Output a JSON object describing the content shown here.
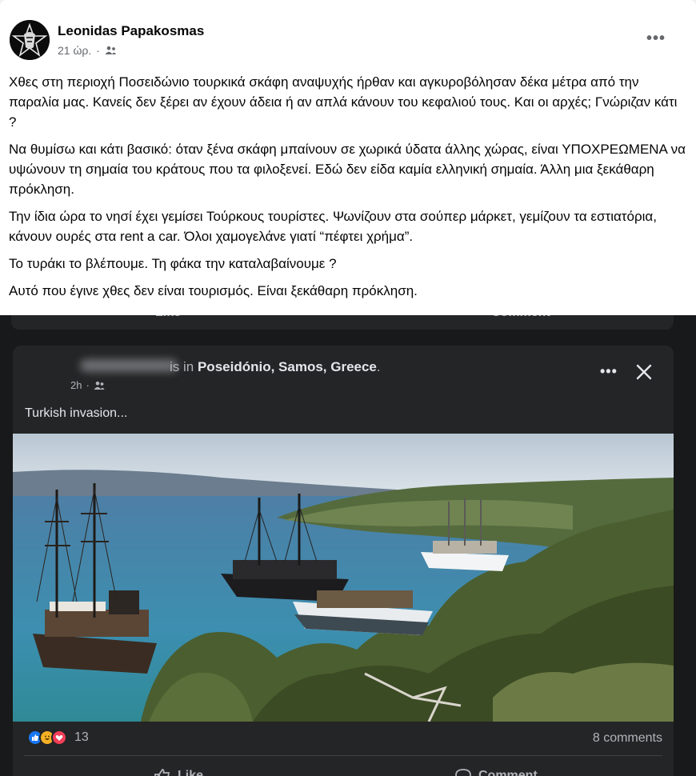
{
  "post": {
    "author": "Leonidas Papakosmas",
    "time": "21 ώρ.",
    "audience_icon": "friends-icon",
    "paragraphs": [
      "Χθες στη περιοχή Ποσειδώνιο τουρκικά σκάφη αναψυχής ήρθαν και αγκυροβόλησαν δέκα μέτρα από την παραλία μας. Κανείς δεν ξέρει αν έχουν άδεια ή αν απλά κάνουν του κεφαλιού τους. Και οι αρχές; Γνώριζαν κάτι ?",
      "Να θυμίσω και κάτι βασικό: όταν ξένα σκάφη μπαίνουν σε χωρικά ύδατα άλλης χώρας, είναι ΥΠΟΧΡΕΩΜΕΝΑ να υψώνουν τη σημαία του κράτους που τα φιλοξενεί. Εδώ δεν είδα καμία ελληνική σημαία. Άλλη μια ξεκάθαρη πρόκληση.",
      "Την ίδια ώρα το νησί έχει γεμίσει Τούρκους τουρίστες. Ψωνίζουν στα σούπερ μάρκετ, γεμίζουν τα εστιατόρια, κάνουν ουρές στα rent a car. Όλοι χαμογελάνε γιατί “πέφτει χρήμα”.",
      "Το τυράκι το βλέπουμε. Τη φάκα την καταλαβαίνουμε ?",
      "Αυτό που έγινε χθες δεν είναι τουρισμός. Είναι ξεκάθαρη πρόκληση."
    ],
    "more_icon": "more-options-icon"
  },
  "shared": {
    "previous_actions": {
      "like": "Like",
      "comment": "Comment"
    },
    "status_suffix": "is in",
    "location": "Poseidónio, Samos, Greece",
    "location_end": ".",
    "time": "2h",
    "text": "Turkish invasion...",
    "reactions": [
      "like",
      "haha",
      "love"
    ],
    "reaction_count": "13",
    "comments": "8 comments",
    "actions": {
      "like": "Like",
      "comment": "Comment"
    }
  },
  "colors": {
    "like": "#1877f2",
    "haha": "#f7b125",
    "love": "#f33e58"
  }
}
